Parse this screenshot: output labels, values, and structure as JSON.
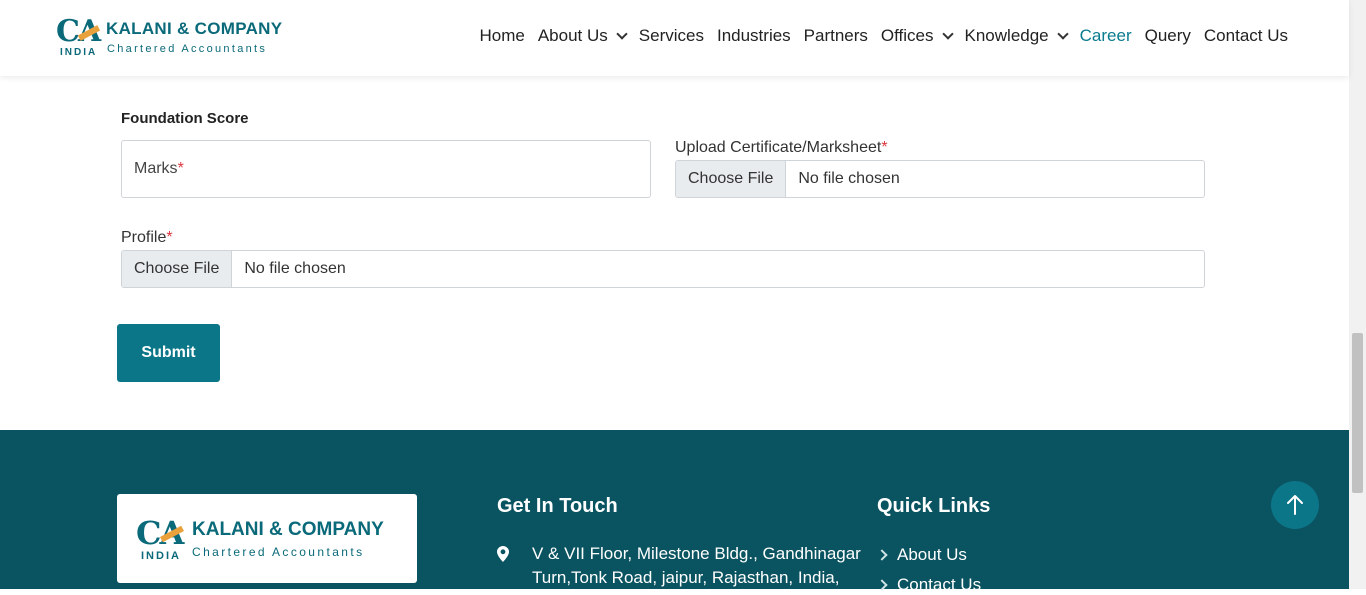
{
  "header": {
    "logo": {
      "mark": "CA",
      "country": "INDIA",
      "name": "KALANI & COMPANY",
      "tagline": "Chartered Accountants"
    },
    "nav": [
      {
        "label": "Home",
        "dropdown": false
      },
      {
        "label": "About Us",
        "dropdown": true
      },
      {
        "label": "Services",
        "dropdown": false
      },
      {
        "label": "Industries",
        "dropdown": false
      },
      {
        "label": "Partners",
        "dropdown": false
      },
      {
        "label": "Offices",
        "dropdown": true
      },
      {
        "label": "Knowledge",
        "dropdown": true
      },
      {
        "label": "Career",
        "dropdown": false,
        "active": true
      },
      {
        "label": "Query",
        "dropdown": false
      },
      {
        "label": "Contact Us",
        "dropdown": false
      }
    ]
  },
  "form": {
    "section_title": "Foundation Score",
    "marks_placeholder": "Marks",
    "required_mark": "*",
    "upload_label": "Upload Certificate/Marksheet",
    "profile_label": "Profile",
    "choose_file": "Choose File",
    "no_file": "No file chosen",
    "submit": "Submit"
  },
  "footer": {
    "logo": {
      "mark": "CA",
      "country": "INDIA",
      "name": "KALANI & COMPANY",
      "tagline": "Chartered Accountants"
    },
    "get_in_touch": "Get In Touch",
    "address": "V & VII Floor, Milestone Bldg., Gandhinagar Turn,Tonk Road, jaipur, Rajasthan, India,",
    "quick_links_title": "Quick Links",
    "quick_links": [
      "About Us",
      "Contact Us"
    ]
  },
  "colors": {
    "brand": "#0b6a7a",
    "accent": "#0c7689",
    "footer_bg": "#0a5360",
    "required": "#d9363e",
    "logo_arrow": "#e9a13b"
  },
  "icons": {
    "to_top": "arrow-up-icon",
    "pin": "map-pin-icon",
    "dropdown": "chevron-down-icon",
    "link": "chevron-right-icon"
  }
}
